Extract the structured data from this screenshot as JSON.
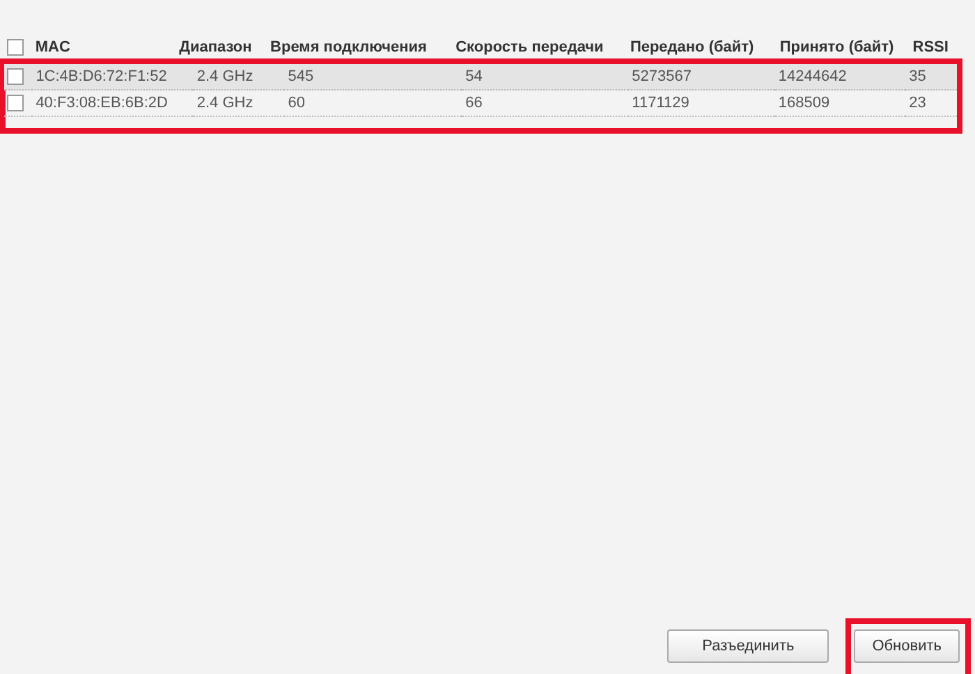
{
  "table": {
    "select_all": {
      "checked": false
    },
    "columns": [
      "MAC",
      "Диапазон",
      "Время подключения",
      "Скорость передачи",
      "Передано (байт)",
      "Принято (байт)",
      "RSSI"
    ],
    "rows": [
      {
        "checked": false,
        "highlighted": true,
        "cells": [
          "1C:4B:D6:72:F1:52",
          "2.4 GHz",
          "545",
          "54",
          "5273567",
          "14244642",
          "35"
        ]
      },
      {
        "checked": false,
        "highlighted": false,
        "cells": [
          "40:F3:08:EB:6B:2D",
          "2.4 GHz",
          "60",
          "66",
          "1171129",
          "168509",
          "23"
        ]
      }
    ]
  },
  "buttons": [
    {
      "label": "Разъединить",
      "marked": false
    },
    {
      "label": "Обновить",
      "marked": true
    }
  ],
  "table_marked": true
}
